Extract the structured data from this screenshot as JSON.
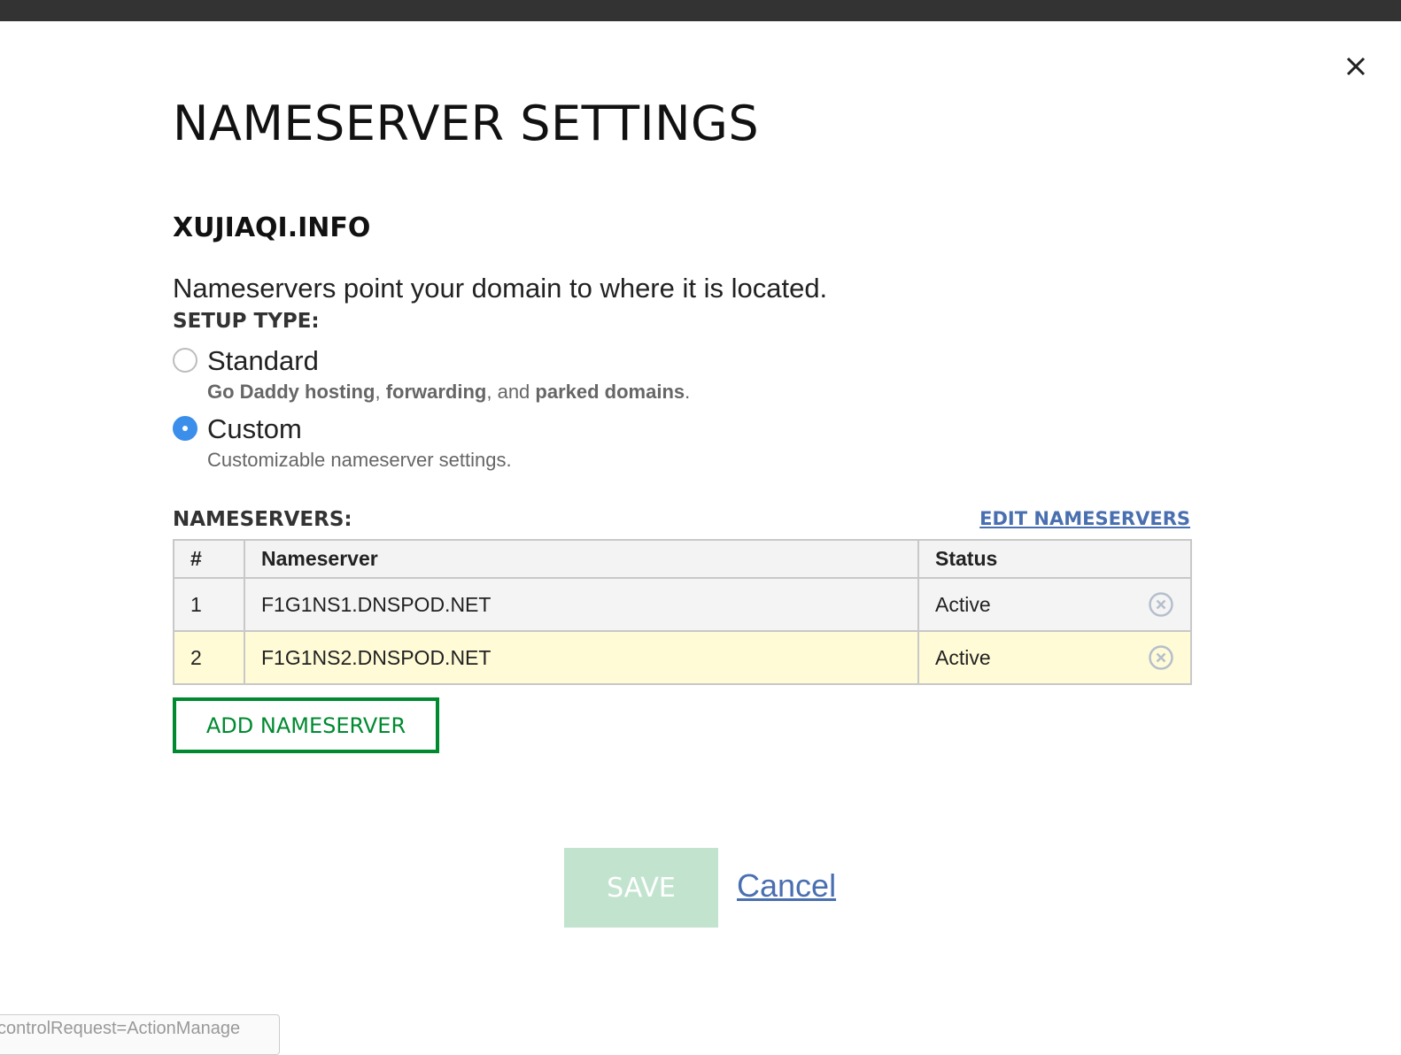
{
  "dialog": {
    "title": "NAMESERVER SETTINGS",
    "domain": "XUJIAQI.INFO",
    "description": "Nameservers point your domain to where it is located.",
    "setup_type_label": "SETUP TYPE:",
    "options": [
      {
        "label": "Standard",
        "selected": false,
        "sub_parts": [
          "Go Daddy hosting",
          ", ",
          "forwarding",
          ", and ",
          "parked domains",
          "."
        ]
      },
      {
        "label": "Custom",
        "selected": true,
        "sub_text": "Customizable nameserver settings."
      }
    ],
    "nameservers_label": "NAMESERVERS:",
    "edit_link": "EDIT NAMESERVERS",
    "table": {
      "headers": [
        "#",
        "Nameserver",
        "Status"
      ],
      "rows": [
        {
          "num": "1",
          "nameserver": "F1G1NS1.DNSPOD.NET",
          "status": "Active"
        },
        {
          "num": "2",
          "nameserver": "F1G1NS2.DNSPOD.NET",
          "status": "Active"
        }
      ]
    },
    "add_button": "ADD NAMESERVER",
    "save_button": "SAVE",
    "cancel_link": "Cancel",
    "close_icon": "close-icon"
  },
  "status_bar": {
    "text": "controlRequest=ActionManage"
  },
  "colors": {
    "accent_green": "#008a30",
    "save_disabled": "#c2e4cf",
    "link_blue": "#4a6fb0",
    "radio_blue": "#3b8eea",
    "highlight_row": "#fffbd6"
  }
}
